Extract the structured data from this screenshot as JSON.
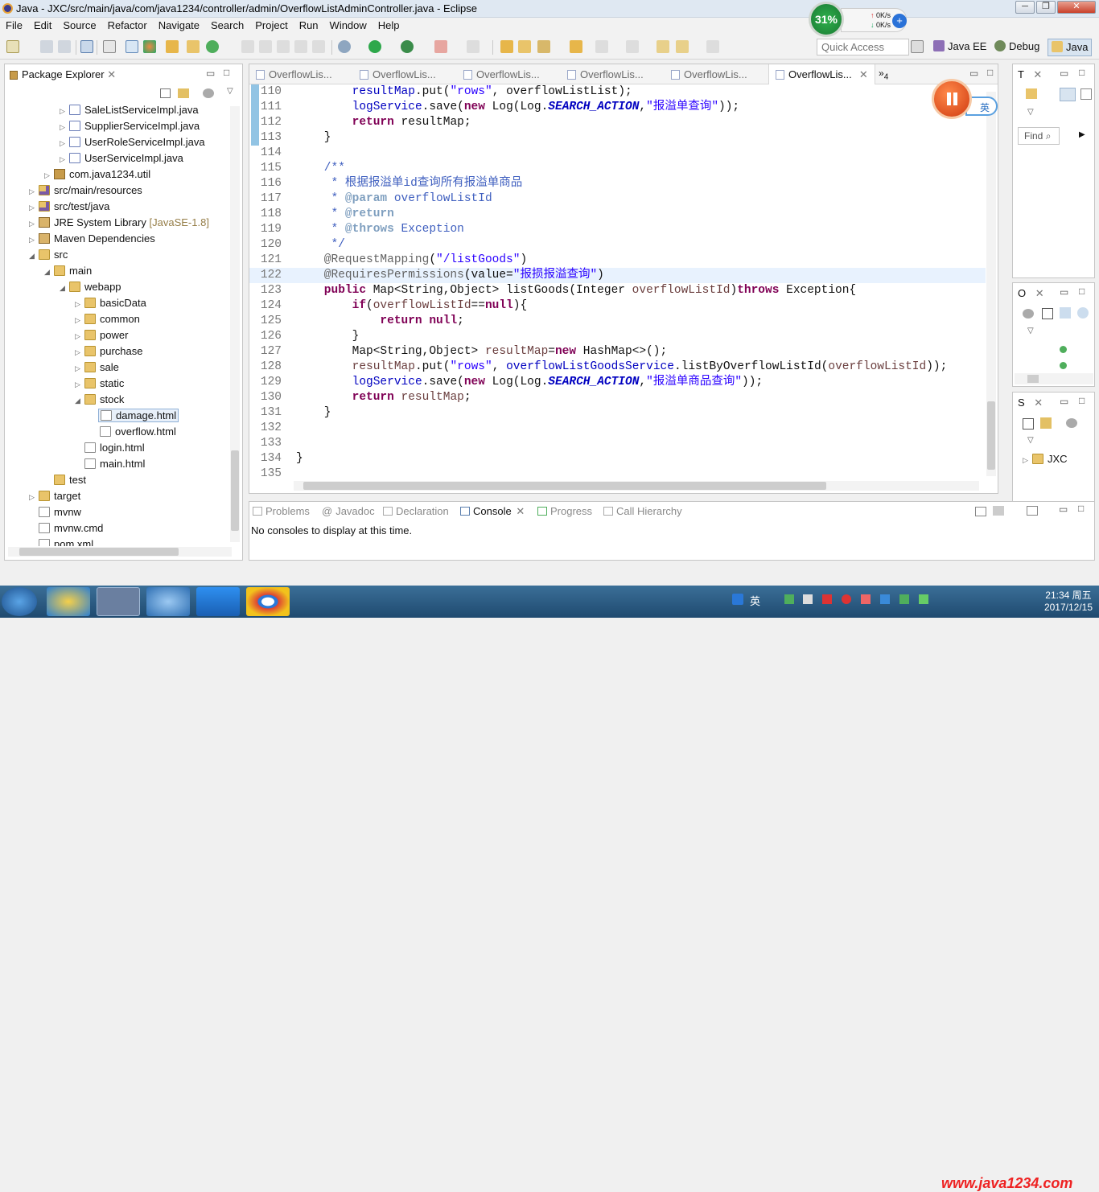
{
  "window": {
    "title": "Java - JXC/src/main/java/com/java1234/controller/admin/OverflowListAdminController.java - Eclipse"
  },
  "menu": [
    "File",
    "Edit",
    "Source",
    "Refactor",
    "Navigate",
    "Search",
    "Project",
    "Run",
    "Window",
    "Help"
  ],
  "toolbar": {
    "quick_access_placeholder": "Quick Access",
    "perspectives": [
      "Java EE",
      "Debug",
      "Java"
    ]
  },
  "speed_widget": {
    "percent": "31%",
    "up": "0K/s",
    "down": "0K/s",
    "plus": "+"
  },
  "package_explorer": {
    "title": "Package Explorer",
    "items": [
      {
        "label": "SaleListServiceImpl.java"
      },
      {
        "label": "SupplierServiceImpl.java"
      },
      {
        "label": "UserRoleServiceImpl.java"
      },
      {
        "label": "UserServiceImpl.java"
      },
      {
        "label": "com.java1234.util"
      },
      {
        "label": "src/main/resources"
      },
      {
        "label": "src/test/java"
      },
      {
        "label": "JRE System Library",
        "suffix": "[JavaSE-1.8]"
      },
      {
        "label": "Maven Dependencies"
      },
      {
        "label": "src"
      },
      {
        "label": "main"
      },
      {
        "label": "webapp"
      },
      {
        "label": "basicData"
      },
      {
        "label": "common"
      },
      {
        "label": "power"
      },
      {
        "label": "purchase"
      },
      {
        "label": "sale"
      },
      {
        "label": "static"
      },
      {
        "label": "stock"
      },
      {
        "label": "damage.html"
      },
      {
        "label": "overflow.html"
      },
      {
        "label": "login.html"
      },
      {
        "label": "main.html"
      },
      {
        "label": "test"
      },
      {
        "label": "target"
      },
      {
        "label": "mvnw"
      },
      {
        "label": "mvnw.cmd"
      },
      {
        "label": "pom.xml"
      }
    ]
  },
  "editor": {
    "tabs": [
      "OverflowLis...",
      "OverflowLis...",
      "OverflowLis...",
      "OverflowLis...",
      "OverflowLis...",
      "OverflowLis..."
    ],
    "overflow_count": "4",
    "lines": [
      {
        "n": "110",
        "parts": [
          [
            "",
            "        "
          ],
          [
            "fld",
            "resultMap"
          ],
          [
            "",
            ".put("
          ],
          [
            "str",
            "\"rows\""
          ],
          [
            "",
            ", overflowListList);"
          ]
        ]
      },
      {
        "n": "111",
        "parts": [
          [
            "",
            "        "
          ],
          [
            "fld",
            "logService"
          ],
          [
            "",
            ".save("
          ],
          [
            "kw",
            "new"
          ],
          [
            "",
            " Log(Log."
          ],
          [
            "sfld",
            "SEARCH_ACTION"
          ],
          [
            "",
            ","
          ],
          [
            "str",
            "\"报溢单查询\""
          ],
          [
            "",
            "));"
          ]
        ]
      },
      {
        "n": "112",
        "parts": [
          [
            "",
            "        "
          ],
          [
            "kw",
            "return"
          ],
          [
            "",
            " resultMap;"
          ]
        ]
      },
      {
        "n": "113",
        "parts": [
          [
            "",
            "    }"
          ]
        ]
      },
      {
        "n": "114",
        "parts": [
          [
            "",
            ""
          ]
        ]
      },
      {
        "n": "115",
        "parts": [
          [
            "cmt",
            "    /**"
          ]
        ]
      },
      {
        "n": "116",
        "parts": [
          [
            "cmt",
            "     * 根据报溢单id查询所有报溢单商品"
          ]
        ]
      },
      {
        "n": "117",
        "parts": [
          [
            "cmt",
            "     * "
          ],
          [
            "tag",
            "@param"
          ],
          [
            "cmt",
            " overflowListId"
          ]
        ]
      },
      {
        "n": "118",
        "parts": [
          [
            "cmt",
            "     * "
          ],
          [
            "tag",
            "@return"
          ]
        ]
      },
      {
        "n": "119",
        "parts": [
          [
            "cmt",
            "     * "
          ],
          [
            "tag",
            "@throws"
          ],
          [
            "cmt",
            " Exception"
          ]
        ]
      },
      {
        "n": "120",
        "parts": [
          [
            "cmt",
            "     */"
          ]
        ]
      },
      {
        "n": "121",
        "parts": [
          [
            "ann",
            "    @RequestMapping"
          ],
          [
            "",
            "("
          ],
          [
            "str",
            "\"/listGoods\""
          ],
          [
            "",
            ")"
          ]
        ]
      },
      {
        "n": "122",
        "parts": [
          [
            "ann",
            "    @RequiresPermissions"
          ],
          [
            "",
            "(value="
          ],
          [
            "str",
            "\"报损报溢查询\""
          ],
          [
            "",
            ")"
          ]
        ]
      },
      {
        "n": "123",
        "parts": [
          [
            "kw",
            "    public"
          ],
          [
            "",
            " Map<String,Object> listGoods(Integer "
          ],
          [
            "par",
            "overflowListId"
          ],
          [
            "",
            ")"
          ],
          [
            "kw",
            "throws"
          ],
          [
            "",
            " Exception{"
          ]
        ]
      },
      {
        "n": "124",
        "parts": [
          [
            "kw",
            "        if"
          ],
          [
            "",
            "("
          ],
          [
            "par",
            "overflowListId"
          ],
          [
            "",
            "=="
          ],
          [
            "kw",
            "null"
          ],
          [
            "",
            "){"
          ]
        ]
      },
      {
        "n": "125",
        "parts": [
          [
            "kw",
            "            return"
          ],
          [
            "kw",
            " null"
          ],
          [
            "",
            ";"
          ]
        ]
      },
      {
        "n": "126",
        "parts": [
          [
            "",
            "        }"
          ]
        ]
      },
      {
        "n": "127",
        "parts": [
          [
            "",
            "        Map<String,Object> "
          ],
          [
            "par",
            "resultMap"
          ],
          [
            "",
            "="
          ],
          [
            "kw",
            "new"
          ],
          [
            "",
            " HashMap<>();"
          ]
        ]
      },
      {
        "n": "128",
        "parts": [
          [
            "",
            "        "
          ],
          [
            "par",
            "resultMap"
          ],
          [
            "",
            ".put("
          ],
          [
            "str",
            "\"rows\""
          ],
          [
            "",
            ", "
          ],
          [
            "fld",
            "overflowListGoodsService"
          ],
          [
            "",
            ".listByOverflowListId("
          ],
          [
            "par",
            "overflowListId"
          ],
          [
            "",
            "));"
          ]
        ]
      },
      {
        "n": "129",
        "parts": [
          [
            "",
            "        "
          ],
          [
            "fld",
            "logService"
          ],
          [
            "",
            ".save("
          ],
          [
            "kw",
            "new"
          ],
          [
            "",
            " Log(Log."
          ],
          [
            "sfld",
            "SEARCH_ACTION"
          ],
          [
            "",
            ","
          ],
          [
            "str",
            "\"报溢单商品查询\""
          ],
          [
            "",
            "));"
          ]
        ]
      },
      {
        "n": "130",
        "parts": [
          [
            "kw",
            "        return"
          ],
          [
            "",
            " "
          ],
          [
            "par",
            "resultMap"
          ],
          [
            "",
            ";"
          ]
        ]
      },
      {
        "n": "131",
        "parts": [
          [
            "",
            "    }"
          ]
        ]
      },
      {
        "n": "132",
        "parts": [
          [
            "",
            ""
          ]
        ]
      },
      {
        "n": "133",
        "parts": [
          [
            "",
            ""
          ]
        ]
      },
      {
        "n": "134",
        "parts": [
          [
            "",
            "}"
          ]
        ]
      },
      {
        "n": "135",
        "parts": [
          [
            "",
            ""
          ]
        ]
      }
    ]
  },
  "console": {
    "tabs": [
      "Problems",
      "Javadoc",
      "Declaration",
      "Console",
      "Progress",
      "Call Hierarchy"
    ],
    "message": "No consoles to display at this time."
  },
  "right_views": {
    "top_tab": "T",
    "find_placeholder": "Find",
    "outline_tab": "O",
    "servers_tab": "S",
    "server_item": "JXC"
  },
  "recorder": {
    "lang": "英"
  },
  "taskbar": {
    "ime": "英",
    "time": "21:34 周五",
    "date": "2017/12/15",
    "watermark": "www.java1234.com"
  }
}
